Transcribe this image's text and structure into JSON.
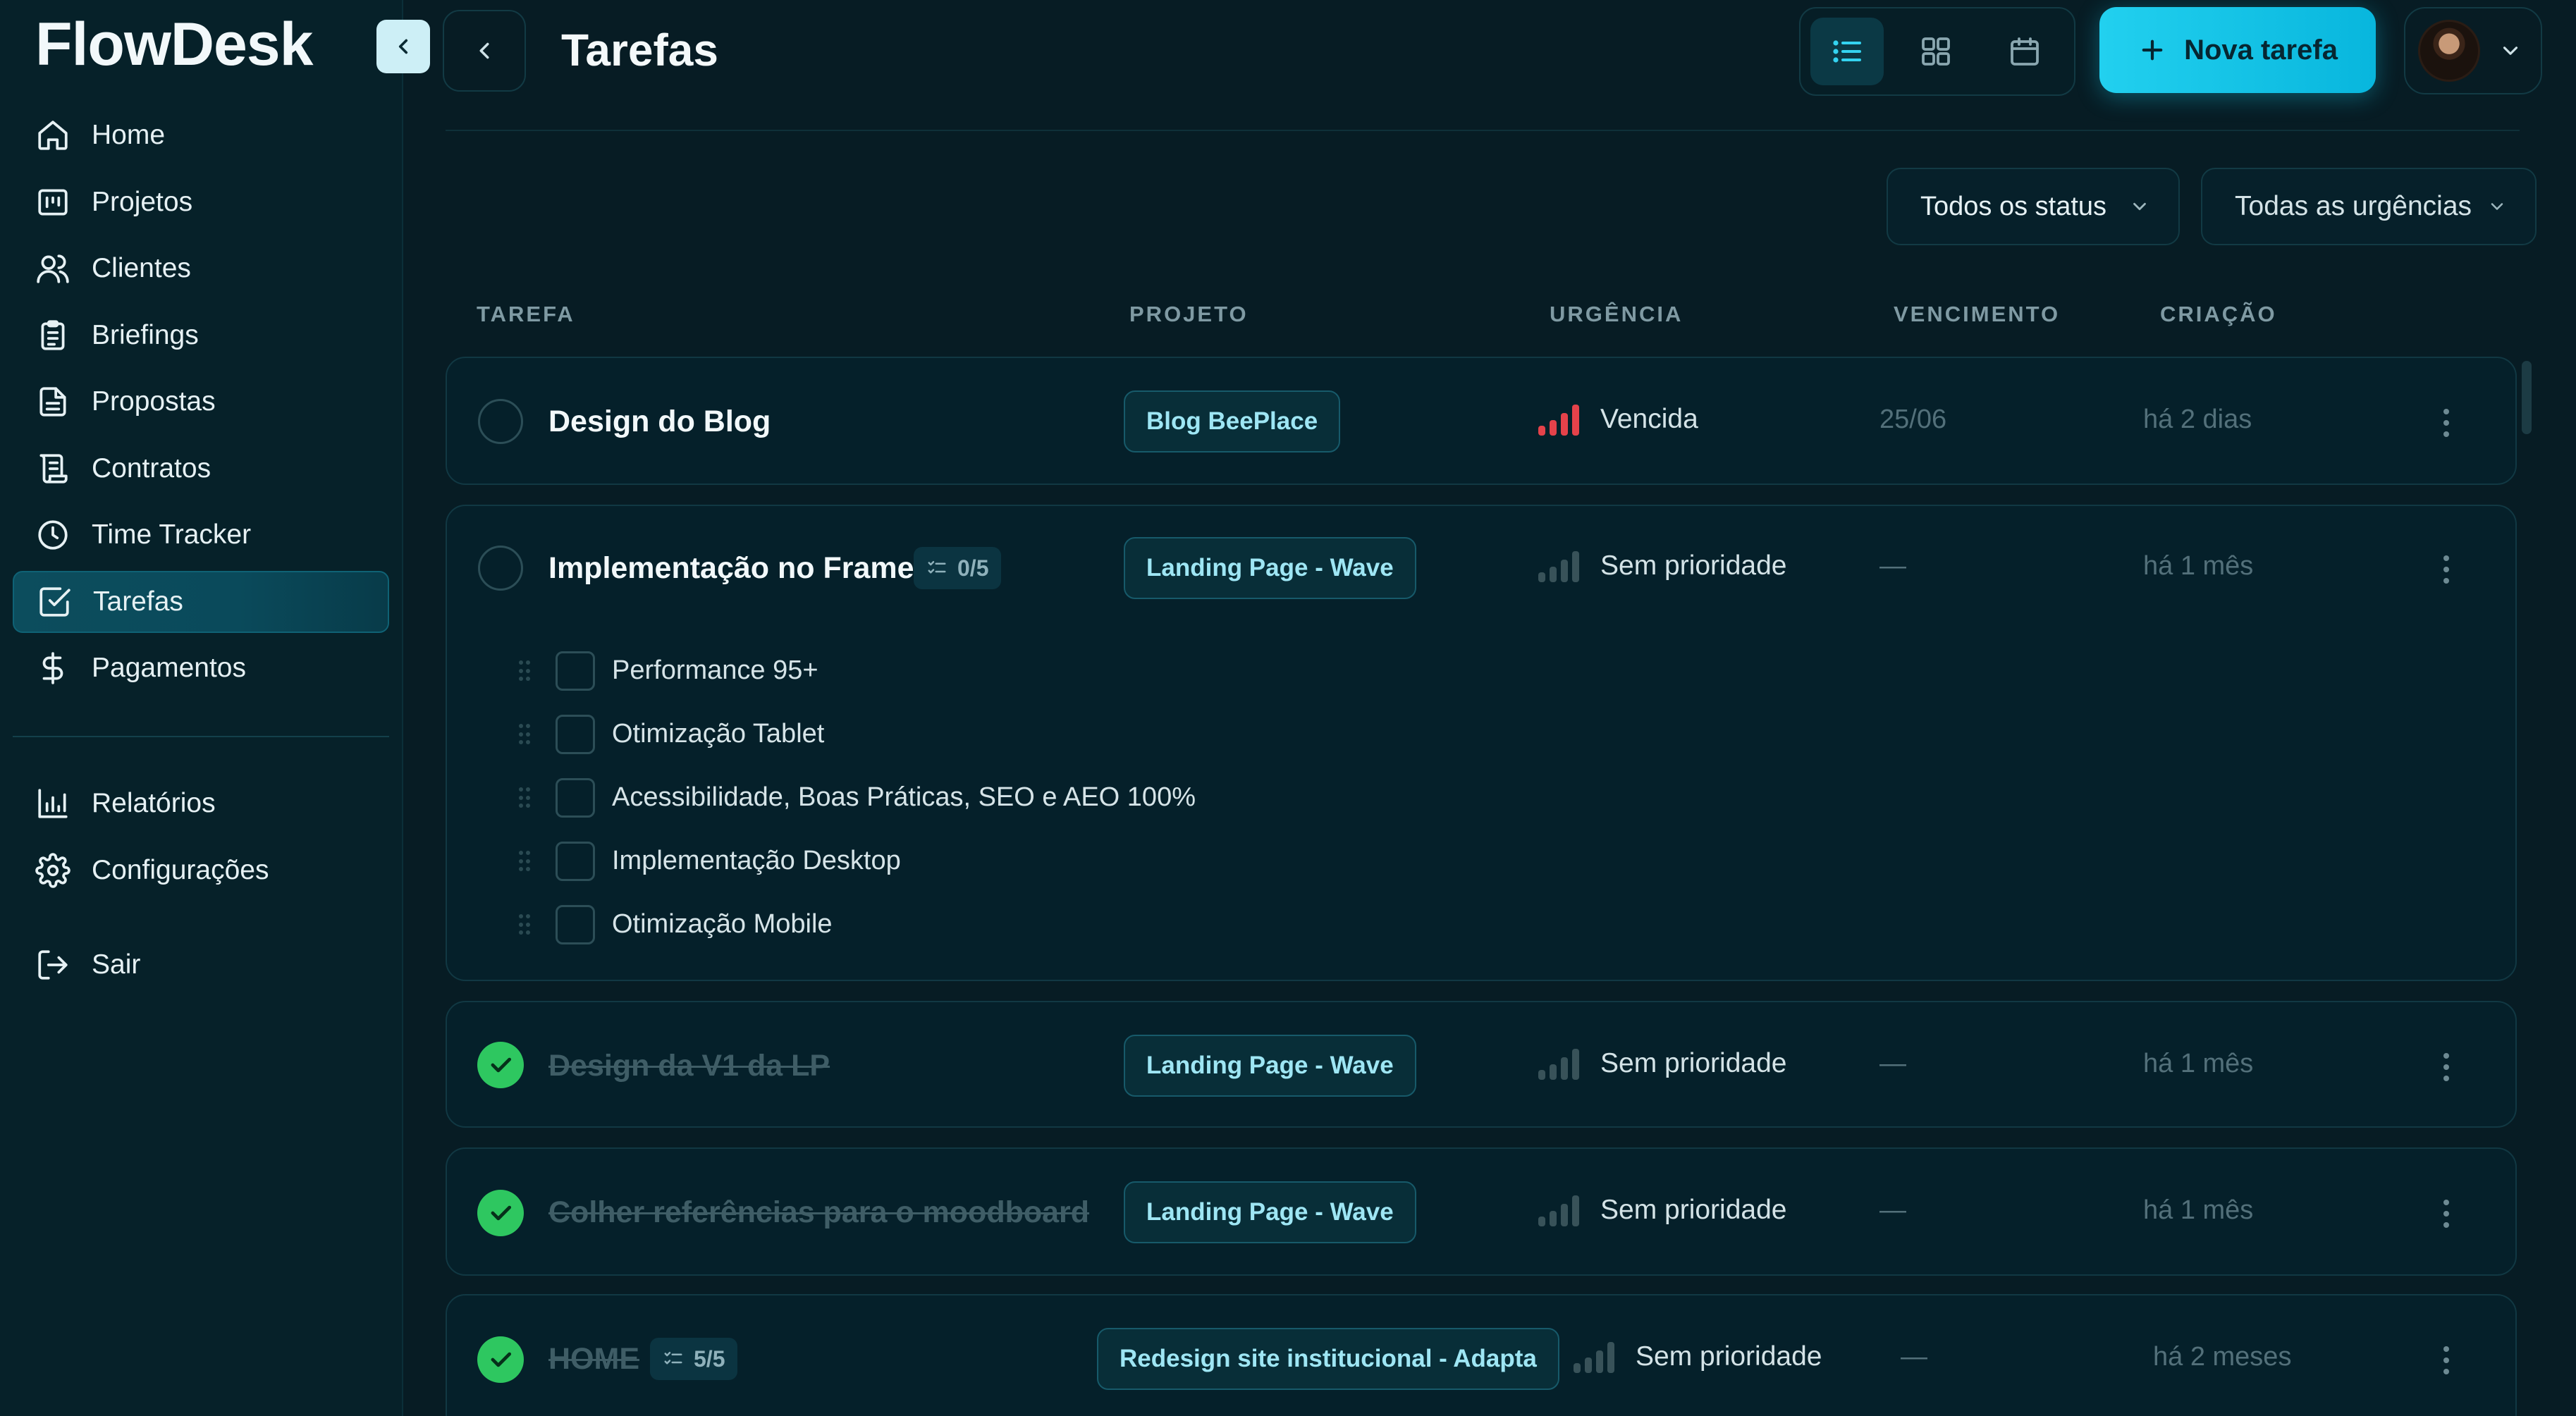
{
  "app": {
    "brand": "FlowDesk"
  },
  "sidebar": {
    "items": [
      {
        "label": "Home",
        "icon": "home-icon"
      },
      {
        "label": "Projetos",
        "icon": "projects-icon"
      },
      {
        "label": "Clientes",
        "icon": "users-icon"
      },
      {
        "label": "Briefings",
        "icon": "clipboard-icon"
      },
      {
        "label": "Propostas",
        "icon": "document-icon"
      },
      {
        "label": "Contratos",
        "icon": "scroll-icon"
      },
      {
        "label": "Time Tracker",
        "icon": "clock-icon"
      },
      {
        "label": "Tarefas",
        "icon": "check-square-icon",
        "active": true
      },
      {
        "label": "Pagamentos",
        "icon": "dollar-icon"
      }
    ],
    "secondary": [
      {
        "label": "Relatórios",
        "icon": "bar-chart-icon"
      },
      {
        "label": "Configurações",
        "icon": "gear-icon"
      }
    ],
    "logout": {
      "label": "Sair",
      "icon": "logout-icon"
    }
  },
  "header": {
    "title": "Tarefas",
    "views": [
      "list-view-icon",
      "grid-view-icon",
      "calendar-view-icon"
    ],
    "active_view": "list",
    "new_task_label": "Nova tarefa"
  },
  "filters": {
    "status": "Todos os status",
    "urgency": "Todas as urgências"
  },
  "table": {
    "headers": {
      "task": "TAREFA",
      "project": "PROJETO",
      "urgency": "URGÊNCIA",
      "due": "VENCIMENTO",
      "created": "CRIAÇÃO"
    },
    "rows": [
      {
        "title": "Design do Blog",
        "done": false,
        "project": "Blog BeePlace",
        "urgency": "Vencida",
        "urgency_level": "overdue",
        "due": "25/06",
        "created": "há 2 dias"
      },
      {
        "title": "Implementação no Framer",
        "done": false,
        "subtask_count": "0/5",
        "project": "Landing Page - Wave",
        "urgency": "Sem prioridade",
        "urgency_level": "none",
        "due": "—",
        "created": "há 1 mês",
        "subtasks": [
          "Performance 95+",
          "Otimização Tablet",
          "Acessibilidade, Boas Práticas, SEO e AEO 100%",
          "Implementação Desktop",
          "Otimização Mobile"
        ]
      },
      {
        "title": "Design da V1 da LP",
        "done": true,
        "project": "Landing Page - Wave",
        "urgency": "Sem prioridade",
        "urgency_level": "none",
        "due": "—",
        "created": "há 1 mês"
      },
      {
        "title": "Colher referências para o moodboard",
        "done": true,
        "project": "Landing Page - Wave",
        "urgency": "Sem prioridade",
        "urgency_level": "none",
        "due": "—",
        "created": "há 1 mês"
      },
      {
        "title": "HOME",
        "done": true,
        "subtask_count": "5/5",
        "project": "Redesign site institucional - Adapta",
        "urgency": "Sem prioridade",
        "urgency_level": "none",
        "due": "—",
        "created": "há 2 meses"
      }
    ]
  },
  "colors": {
    "accent": "#14c6e8",
    "background": "#071c24",
    "sidebar": "#062129",
    "done": "#2ec760",
    "overdue": "#e5424a"
  }
}
